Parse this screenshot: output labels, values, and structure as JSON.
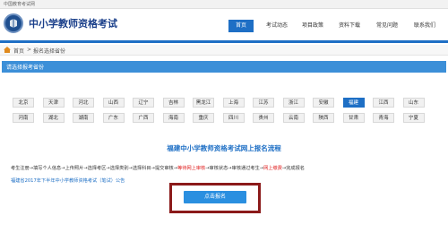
{
  "topbar": {
    "text": "中国教育考试网"
  },
  "header": {
    "title": "中小学教师资格考试"
  },
  "nav": [
    {
      "label": "首页",
      "active": true
    },
    {
      "label": "考试动态",
      "active": false
    },
    {
      "label": "项目政策",
      "active": false
    },
    {
      "label": "资料下载",
      "active": false
    },
    {
      "label": "常见问题",
      "active": false
    },
    {
      "label": "联系我们",
      "active": false
    }
  ],
  "breadcrumb": {
    "home": "首页",
    "sep": ">",
    "current": "报名选择省份"
  },
  "section": {
    "title": "请选择报考省份"
  },
  "provinces": {
    "row1": [
      "北京",
      "天津",
      "河北",
      "山西",
      "辽宁",
      "吉林",
      "黑龙江",
      "上海",
      "江苏",
      "浙江",
      "安徽",
      "福建",
      "江西",
      "山东"
    ],
    "row2": [
      "河南",
      "湖北",
      "湖南",
      "广东",
      "广西",
      "海南",
      "重庆",
      "四川",
      "贵州",
      "云南",
      "陕西",
      "甘肃",
      "青海",
      "宁夏"
    ],
    "selected": "福建"
  },
  "flow": {
    "title": "福建中小学教师资格考试网上报名流程",
    "before": "考生注册→填写个人信息→上传照片→选择考区→选择类别→选择科目→提交审核→",
    "red1": "等待网上审核",
    "middle": "→审核状态→审核通过考生→",
    "red2": "网上缴费",
    "after": "→完成报名"
  },
  "notice": {
    "text": "福建省2017年下半年中小学教师资格考试（笔试）公告"
  },
  "apply_button": {
    "label": "点击报名"
  }
}
